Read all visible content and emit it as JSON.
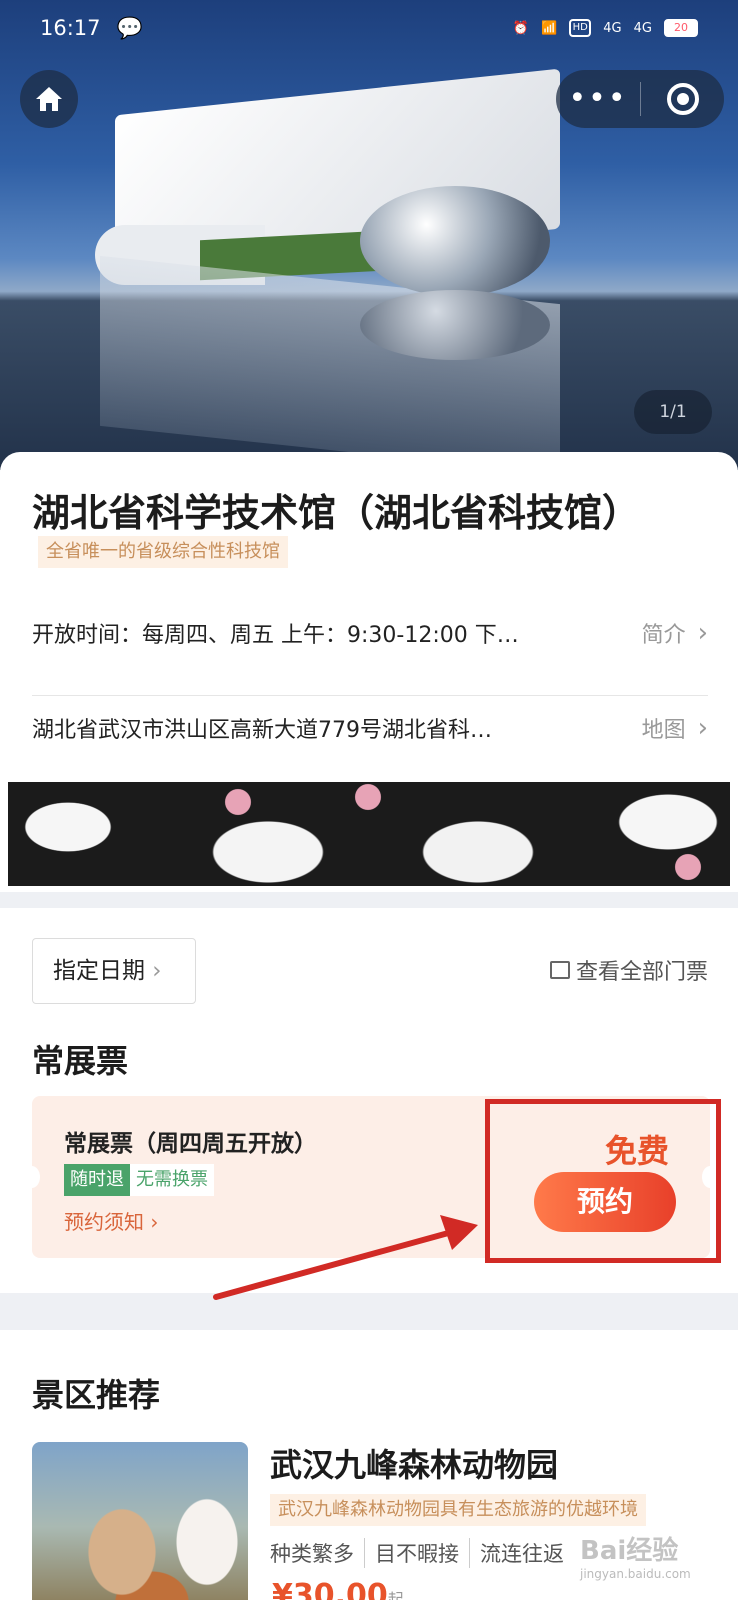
{
  "status_bar": {
    "time": "16:17",
    "signal1": "4G",
    "signal2": "4G",
    "hd": "HD",
    "battery": "20"
  },
  "hero": {
    "counter": "1/1"
  },
  "venue": {
    "title": "湖北省科学技术馆（湖北省科技馆）",
    "tagline": "全省唯一的省级综合性科技馆",
    "hours": "开放时间：每周四、周五 上午：9:30-12:00 下…",
    "hours_action": "简介",
    "address": "湖北省武汉市洪山区高新大道779号湖北省科…",
    "address_action": "地图"
  },
  "tickets": {
    "date_button": "指定日期",
    "view_all": "查看全部门票",
    "section_title": "常展票",
    "card": {
      "name": "常展票（周四周五开放）",
      "tag_refund": "随时退",
      "tag_no_exchange": "无需换票",
      "notice": "预约须知",
      "price": "免费",
      "book": "预约"
    }
  },
  "recommend": {
    "title": "景区推荐",
    "item": {
      "name": "武汉九峰森林动物园",
      "desc": "武汉九峰森林动物园具有生态旅游的优越环境",
      "features": [
        "种类繁多",
        "目不暇接",
        "流连往返"
      ],
      "price": "¥30.00",
      "price_suffix": "起"
    }
  },
  "watermark": {
    "brand": "Bai经验",
    "site": "jingyan.baidu.com"
  },
  "colors": {
    "accent": "#e8532b",
    "highlight": "#d12a25",
    "tag_green": "#4aa36a",
    "tag_beige": "#fdf0e4"
  }
}
